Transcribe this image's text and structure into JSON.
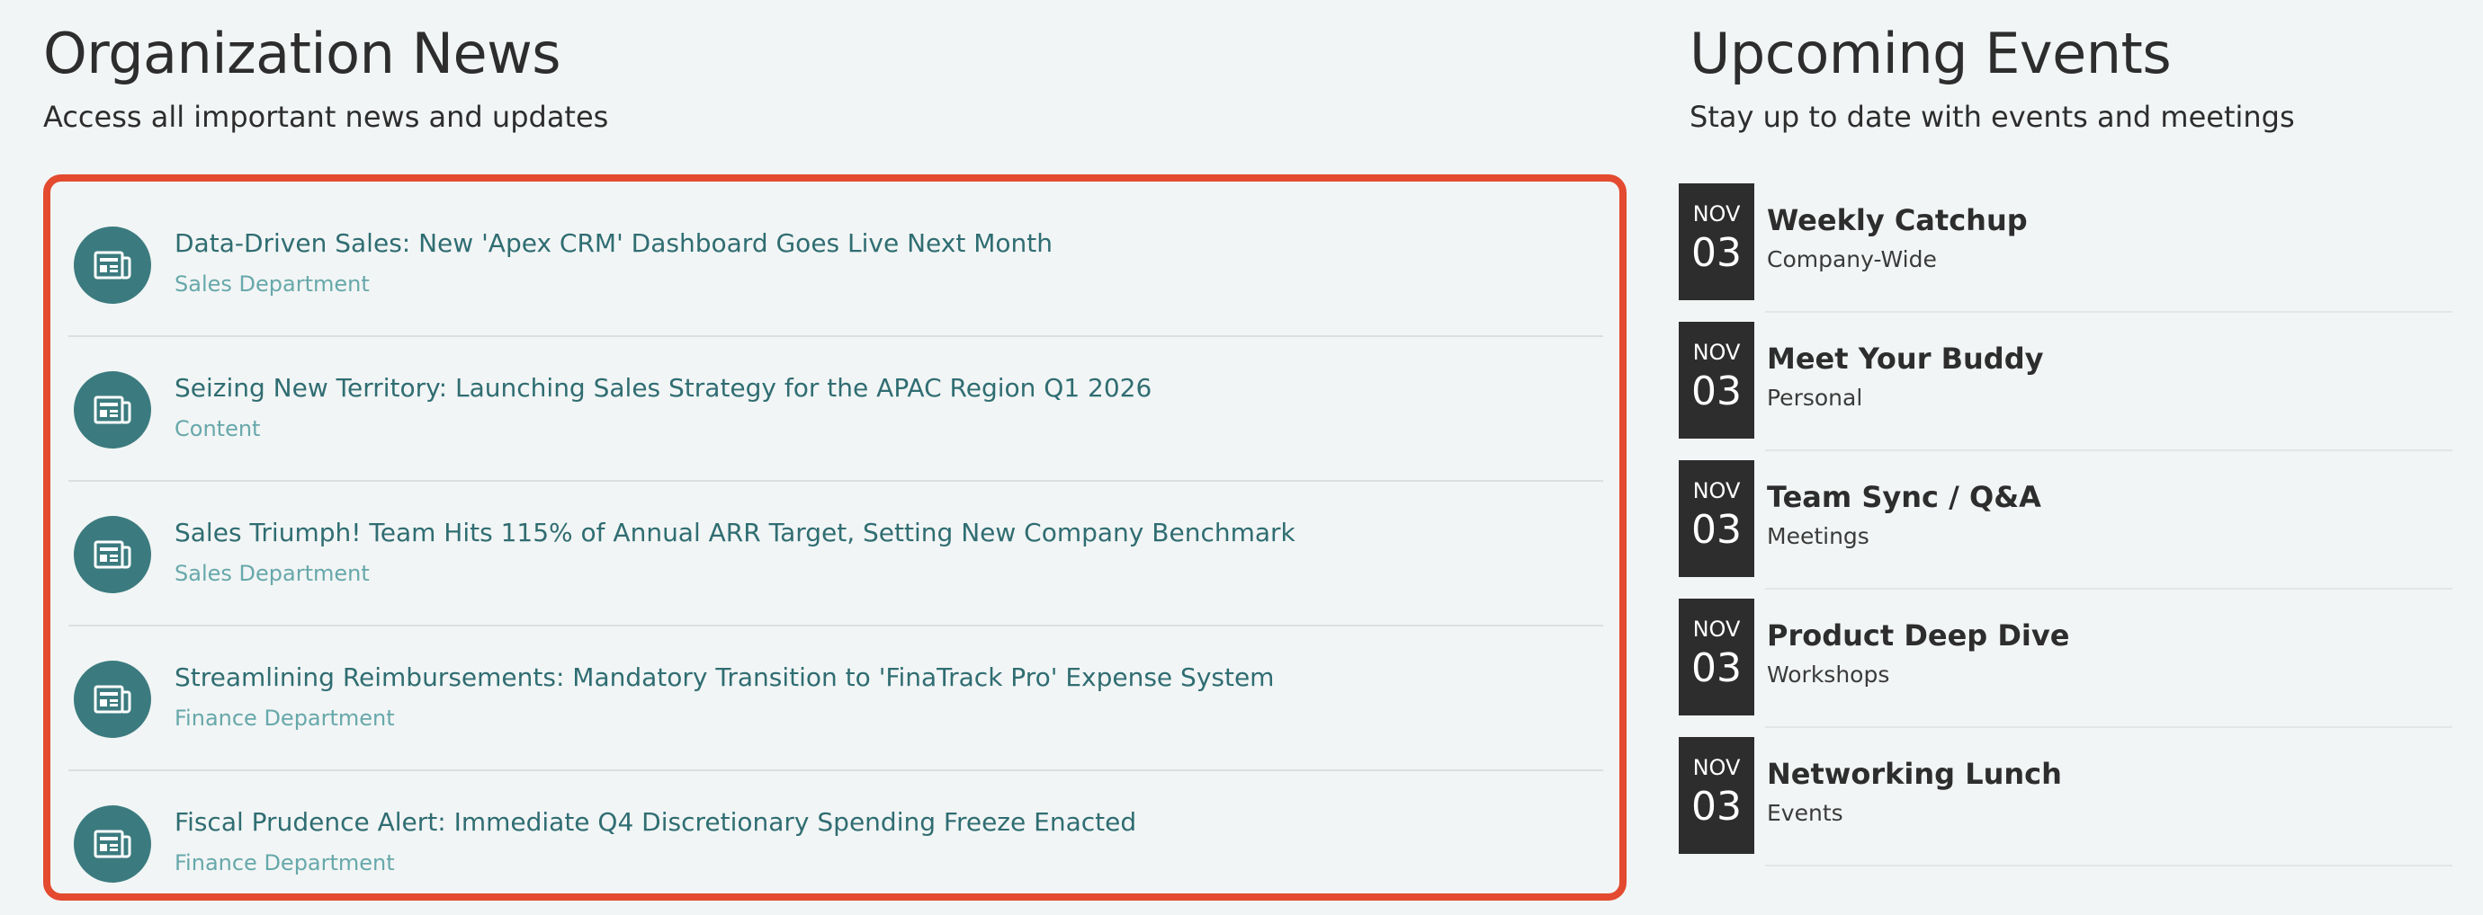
{
  "news": {
    "title": "Organization News",
    "subtitle": "Access all important news and updates",
    "highlight_color": "#e34a2f",
    "icon": "newspaper-icon",
    "items": [
      {
        "title": "Data-Driven Sales: New 'Apex CRM' Dashboard Goes Live Next Month",
        "department": "Sales Department"
      },
      {
        "title": "Seizing New Territory: Launching Sales Strategy for the APAC Region Q1 2026",
        "department": "Content"
      },
      {
        "title": "Sales Triumph! Team Hits 115% of Annual ARR Target, Setting New Company Benchmark",
        "department": "Sales Department"
      },
      {
        "title": "Streamlining Reimbursements: Mandatory Transition to 'FinaTrack Pro' Expense System",
        "department": "Finance Department"
      },
      {
        "title": "Fiscal Prudence Alert: Immediate Q4 Discretionary Spending Freeze Enacted",
        "department": "Finance Department"
      }
    ]
  },
  "events": {
    "title": "Upcoming Events",
    "subtitle": "Stay up to date with events and meetings",
    "items": [
      {
        "month": "NOV",
        "day": "03",
        "name": "Weekly Catchup",
        "category": "Company-Wide"
      },
      {
        "month": "NOV",
        "day": "03",
        "name": "Meet Your Buddy",
        "category": "Personal"
      },
      {
        "month": "NOV",
        "day": "03",
        "name": "Team Sync / Q&A",
        "category": "Meetings"
      },
      {
        "month": "NOV",
        "day": "03",
        "name": "Product Deep Dive",
        "category": "Workshops"
      },
      {
        "month": "NOV",
        "day": "03",
        "name": "Networking Lunch",
        "category": "Events"
      }
    ]
  }
}
